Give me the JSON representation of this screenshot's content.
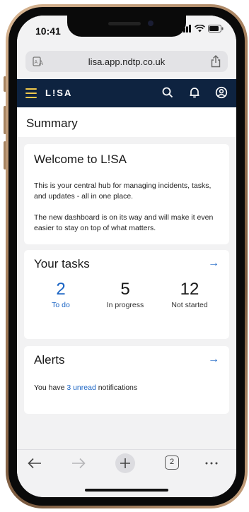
{
  "status": {
    "time": "10:41"
  },
  "browser": {
    "url": "lisa.app.ndtp.co.uk",
    "tab_count": "2"
  },
  "app": {
    "brand": "L!SA"
  },
  "page": {
    "title": "Summary"
  },
  "welcome": {
    "title": "Welcome to L!SA",
    "para1": "This is your central hub for managing incidents, tasks, and updates - all in one place.",
    "para2": "The new dashboard is on its way and will make it even easier to stay on top of what matters."
  },
  "tasks": {
    "title": "Your tasks",
    "arrow": "→",
    "stats": [
      {
        "value": "2",
        "label": "To do"
      },
      {
        "value": "5",
        "label": "In progress"
      },
      {
        "value": "12",
        "label": "Not started"
      }
    ]
  },
  "alerts": {
    "title": "Alerts",
    "arrow": "→",
    "prefix": "You have ",
    "unread": "3 unread",
    "suffix": " notifications"
  },
  "colors": {
    "navbar": "#0e2340",
    "accent": "#1a64c4",
    "menu_icon": "#f0c84c"
  },
  "icons": [
    "reader-icon",
    "share-icon",
    "menu-icon",
    "search-icon",
    "bell-icon",
    "account-icon",
    "back-icon",
    "forward-icon",
    "plus-icon",
    "tabs-icon",
    "more-icon"
  ]
}
